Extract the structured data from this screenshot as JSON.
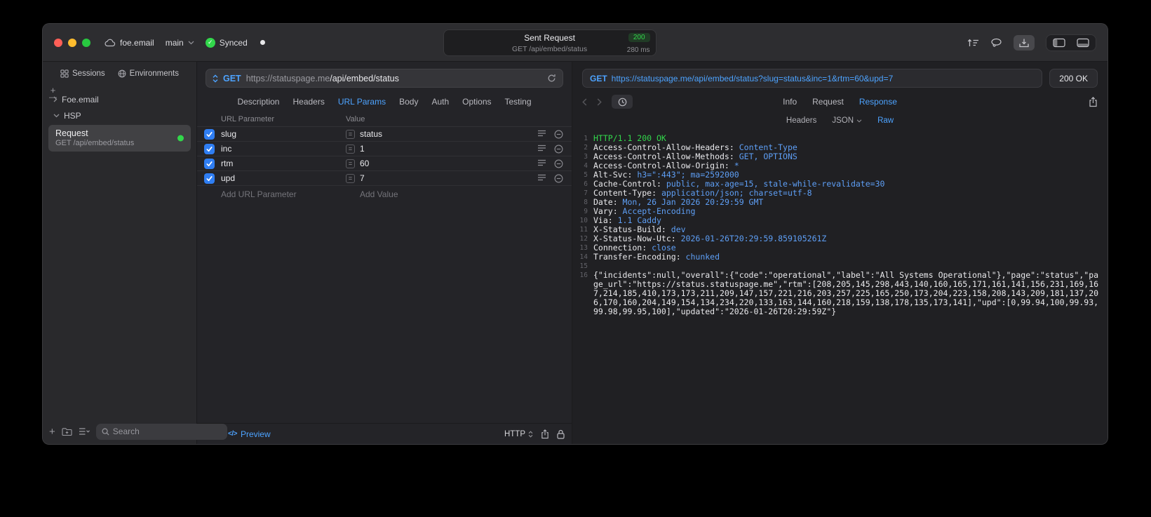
{
  "titlebar": {
    "project": "foe.email",
    "branch": "main",
    "sync_label": "Synced",
    "request_title": "Sent Request",
    "status_code": "200",
    "request_line": "GET /api/embed/status",
    "duration": "280 ms"
  },
  "sidebar": {
    "tabs": [
      {
        "label": "Sessions"
      },
      {
        "label": "Environments"
      }
    ],
    "tree": [
      {
        "label": "Foe.email",
        "expanded": false
      },
      {
        "label": "HSP",
        "expanded": true
      }
    ],
    "request_item": {
      "title": "Request",
      "subtitle": "GET /api/embed/status"
    },
    "search_placeholder": "Search"
  },
  "request_panel": {
    "method": "GET",
    "url_host": "https://statuspage.me",
    "url_path": "/api/embed/status",
    "tabs": [
      "Description",
      "Headers",
      "URL Params",
      "Body",
      "Auth",
      "Options",
      "Testing"
    ],
    "active_tab": "URL Params",
    "table": {
      "name_header": "URL Parameter",
      "value_header": "Value",
      "rows": [
        {
          "name": "slug",
          "value": "status",
          "checked": true
        },
        {
          "name": "inc",
          "value": "1",
          "checked": true
        },
        {
          "name": "rtm",
          "value": "60",
          "checked": true
        },
        {
          "name": "upd",
          "value": "7",
          "checked": true
        }
      ],
      "add_name_placeholder": "Add URL Parameter",
      "add_value_placeholder": "Add Value"
    },
    "footer": {
      "preview_label": "Preview",
      "protocol_label": "HTTP"
    }
  },
  "response_panel": {
    "method": "GET",
    "url": "https://statuspage.me/api/embed/status?slug=status&inc=1&rtm=60&upd=7",
    "status": "200 OK",
    "tabs": [
      "Info",
      "Request",
      "Response"
    ],
    "active_tab": "Response",
    "subtabs": [
      {
        "label": "Headers",
        "has_menu": false
      },
      {
        "label": "JSON",
        "has_menu": true
      },
      {
        "label": "Raw",
        "has_menu": false
      }
    ],
    "active_subtab": "Raw",
    "lines": [
      {
        "n": "1",
        "kind": "status",
        "text": "HTTP/1.1 200 OK"
      },
      {
        "n": "2",
        "kind": "header",
        "name": "Access-Control-Allow-Headers",
        "value": "Content-Type"
      },
      {
        "n": "3",
        "kind": "header",
        "name": "Access-Control-Allow-Methods",
        "value": "GET, OPTIONS"
      },
      {
        "n": "4",
        "kind": "header",
        "name": "Access-Control-Allow-Origin",
        "value": "*"
      },
      {
        "n": "5",
        "kind": "header",
        "name": "Alt-Svc",
        "value": "h3=\":443\"; ma=2592000"
      },
      {
        "n": "6",
        "kind": "header",
        "name": "Cache-Control",
        "value": "public, max-age=15, stale-while-revalidate=30"
      },
      {
        "n": "7",
        "kind": "header",
        "name": "Content-Type",
        "value": "application/json; charset=utf-8"
      },
      {
        "n": "8",
        "kind": "header",
        "name": "Date",
        "value": "Mon, 26 Jan 2026 20:29:59 GMT"
      },
      {
        "n": "9",
        "kind": "header",
        "name": "Vary",
        "value": "Accept-Encoding"
      },
      {
        "n": "10",
        "kind": "header",
        "name": "Via",
        "value": "1.1 Caddy"
      },
      {
        "n": "11",
        "kind": "header",
        "name": "X-Status-Build",
        "value": "dev"
      },
      {
        "n": "12",
        "kind": "header",
        "name": "X-Status-Now-Utc",
        "value": "2026-01-26T20:29:59.859105261Z"
      },
      {
        "n": "13",
        "kind": "header",
        "name": "Connection",
        "value": "close"
      },
      {
        "n": "14",
        "kind": "header",
        "name": "Transfer-Encoding",
        "value": "chunked"
      },
      {
        "n": "15",
        "kind": "blank"
      },
      {
        "n": "16",
        "kind": "body",
        "text": "{\"incidents\":null,\"overall\":{\"code\":\"operational\",\"label\":\"All Systems Operational\"},\"page\":\"status\",\"page_url\":\"https://status.statuspage.me\",\"rtm\":[208,205,145,298,443,140,160,165,171,161,141,156,231,169,167,214,185,410,173,173,211,209,147,157,221,216,203,257,225,165,250,173,204,223,158,208,143,209,181,137,206,170,160,204,149,154,134,234,220,133,163,144,160,218,159,138,178,135,173,141],\"upd\":[0,99.94,100,99.93,99.98,99.95,100],\"updated\":\"2026-01-26T20:29:59Z\"}"
      }
    ]
  },
  "colors": {
    "accent_blue": "#4da3ff",
    "status_green": "#32d74b",
    "checkbox_blue": "#2f7ef3"
  }
}
